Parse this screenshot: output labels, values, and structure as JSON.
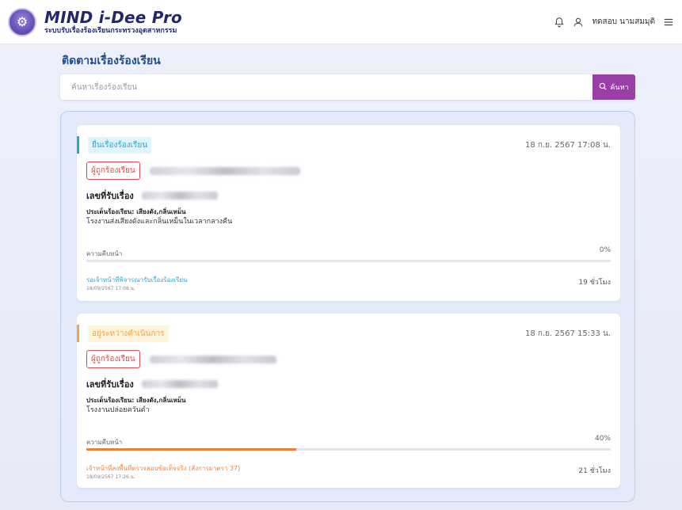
{
  "header": {
    "app_name": "MIND i-Dee Pro",
    "subtitle": "ระบบรับเรื่องร้องเรียนกระทรวงอุตสาหกรรม",
    "user_name": "ทดสอบ นามสมมุติ",
    "icons": [
      "bell-icon",
      "user-icon",
      "menu-icon"
    ]
  },
  "page_title": "ติดตามเรื่องร้องเรียน",
  "search": {
    "placeholder": "ค้นหาเรื่องร้องเรียน",
    "value": "",
    "button_label": "ค้นหา"
  },
  "complaints": [
    {
      "status": "ยื่นเรื่องร้องเรียน",
      "datetime": "18 ก.ย. 2567 17:08 น.",
      "role_label": "ผู้ถูกร้องเรียน",
      "reference_label": "เลขที่รับเรื่อง",
      "issue": "ประเด็นร้องเรียน: เสียงดัง,กลิ่นเหม็น",
      "description": "โรงงานส่งเสียงดังและกลิ่นเหม็นในเวลากลางคืน",
      "progress_label": "ความคืบหน้า",
      "progress": "0%",
      "progress_value": 0,
      "step": "รอเจ้าหน้าที่พิจารณารับเรื่องร้องเรียน",
      "step_date": "18/09/2567 17:08 น.",
      "duration": "19 ชั่วโมง",
      "accent": "#2aa6cc"
    },
    {
      "status": "อยู่ระหว่างดำเนินการ",
      "datetime": "18 ก.ย. 2567 15:33 น.",
      "role_label": "ผู้ถูกร้องเรียน",
      "reference_label": "เลขที่รับเรื่อง",
      "issue": "ประเด็นร้องเรียน: เสียงดัง,กลิ่นเหม็น",
      "description": "โรงงานปล่อยควันดำ",
      "progress_label": "ความคืบหน้า",
      "progress": "40%",
      "progress_value": 0.4,
      "step": "เจ้าหน้าที่ลงพื้นที่ตรวจสอบข้อเท็จจริง (สั่งการมาตรา 37)",
      "step_date": "18/09/2567 17:26 น.",
      "duration": "21 ชั่วโมง",
      "accent": "#f2a542"
    }
  ]
}
